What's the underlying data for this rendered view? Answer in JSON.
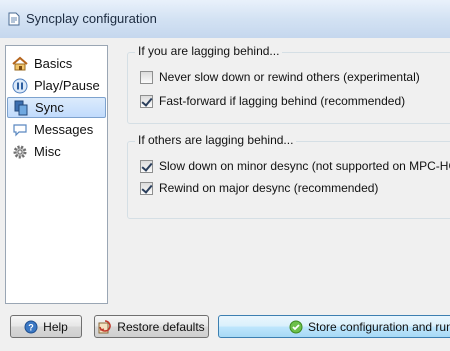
{
  "window": {
    "title": "Syncplay configuration"
  },
  "sidebar": {
    "items": [
      {
        "label": "Basics",
        "icon": "home-icon",
        "selected": false
      },
      {
        "label": "Play/Pause",
        "icon": "pause-icon",
        "selected": false
      },
      {
        "label": "Sync",
        "icon": "sync-icon",
        "selected": true
      },
      {
        "label": "Messages",
        "icon": "speech-bubble-icon",
        "selected": false
      },
      {
        "label": "Misc",
        "icon": "gear-icon",
        "selected": false
      }
    ]
  },
  "groups": [
    {
      "title": "If you are lagging behind...",
      "options": [
        {
          "label": "Never slow down or rewind others (experimental)",
          "checked": false
        },
        {
          "label": "Fast-forward if lagging behind (recommended)",
          "checked": true
        }
      ]
    },
    {
      "title": "If others are lagging behind...",
      "options": [
        {
          "label": "Slow down on minor desync (not supported on MPC-HC)",
          "checked": true
        },
        {
          "label": "Rewind on major desync (recommended)",
          "checked": true
        }
      ]
    }
  ],
  "buttons": {
    "help": "Help",
    "restore": "Restore defaults",
    "store": "Store configuration and run"
  },
  "colors": {
    "accent": "#3c7fb1",
    "selection": "#c1dbfc"
  }
}
